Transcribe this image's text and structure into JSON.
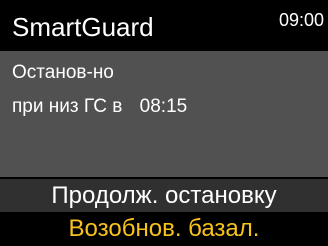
{
  "header": {
    "title": "SmartGuard",
    "time": "09:00"
  },
  "status": {
    "line1": "Останов-но",
    "line2_label": "при низ ГС в",
    "line2_time": "08:15"
  },
  "menu": {
    "items": [
      {
        "label": "Продолж. остановку",
        "selected": false
      },
      {
        "label": "Возобнов. базал.",
        "selected": true
      }
    ]
  },
  "colors": {
    "background": "#000000",
    "panel": "#515151",
    "highlight_text": "#f7c21b",
    "text": "#ffffff"
  }
}
